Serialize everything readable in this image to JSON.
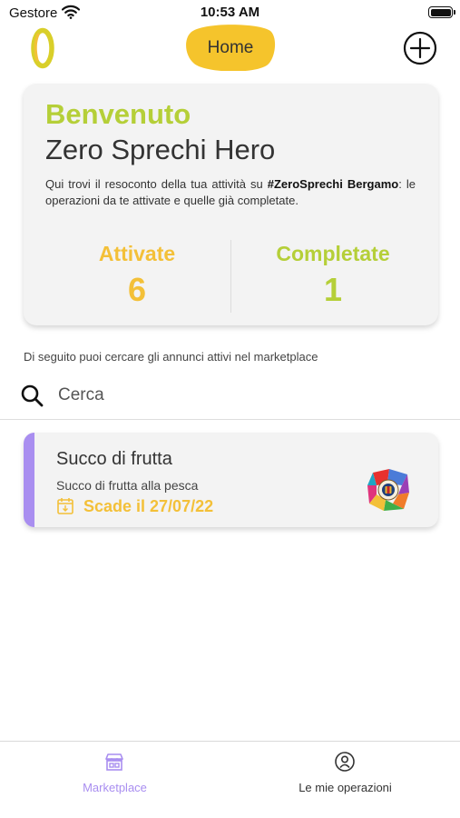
{
  "status_bar": {
    "carrier": "Gestore",
    "time": "10:53 AM",
    "icons": [
      "wifi-icon",
      "battery-icon"
    ]
  },
  "header": {
    "logo_icon": "zero-logo-icon",
    "home_label": "Home",
    "add_icon": "plus-circle-icon"
  },
  "welcome": {
    "title": "Benvenuto",
    "subtitle": "Zero Sprechi Hero",
    "description_before": "Qui trovi il resoconto della tua attività su ",
    "description_bold": "#ZeroSprechi Bergamo",
    "description_after": ": le operazioni da te attivate e quelle già completate."
  },
  "stats": {
    "activated_label": "Attivate",
    "activated_value": "6",
    "completed_label": "Completate",
    "completed_value": "1"
  },
  "hint_text": "Di seguito puoi cercare gli annunci attivi nel marketplace",
  "search": {
    "placeholder": "Cerca",
    "value": "",
    "icon": "search-icon"
  },
  "listings": [
    {
      "title": "Succo di frutta",
      "description": "Succo di frutta alla pesca",
      "expiry": "Scade il 27/07/22",
      "expiry_icon": "calendar-icon",
      "shop_logo": "shop-logo-icon"
    }
  ],
  "tab_bar": {
    "items": [
      {
        "label": "Marketplace",
        "icon": "store-icon",
        "active": true
      },
      {
        "label": "Le mie operazioni",
        "icon": "user-circle-icon",
        "active": false
      }
    ]
  },
  "colors": {
    "brand_green": "#b5cf38",
    "brand_yellow": "#f3c038",
    "accent_purple": "#a98ef0",
    "card_bg": "#f3f3f3",
    "home_pill": "#f5c42c"
  }
}
